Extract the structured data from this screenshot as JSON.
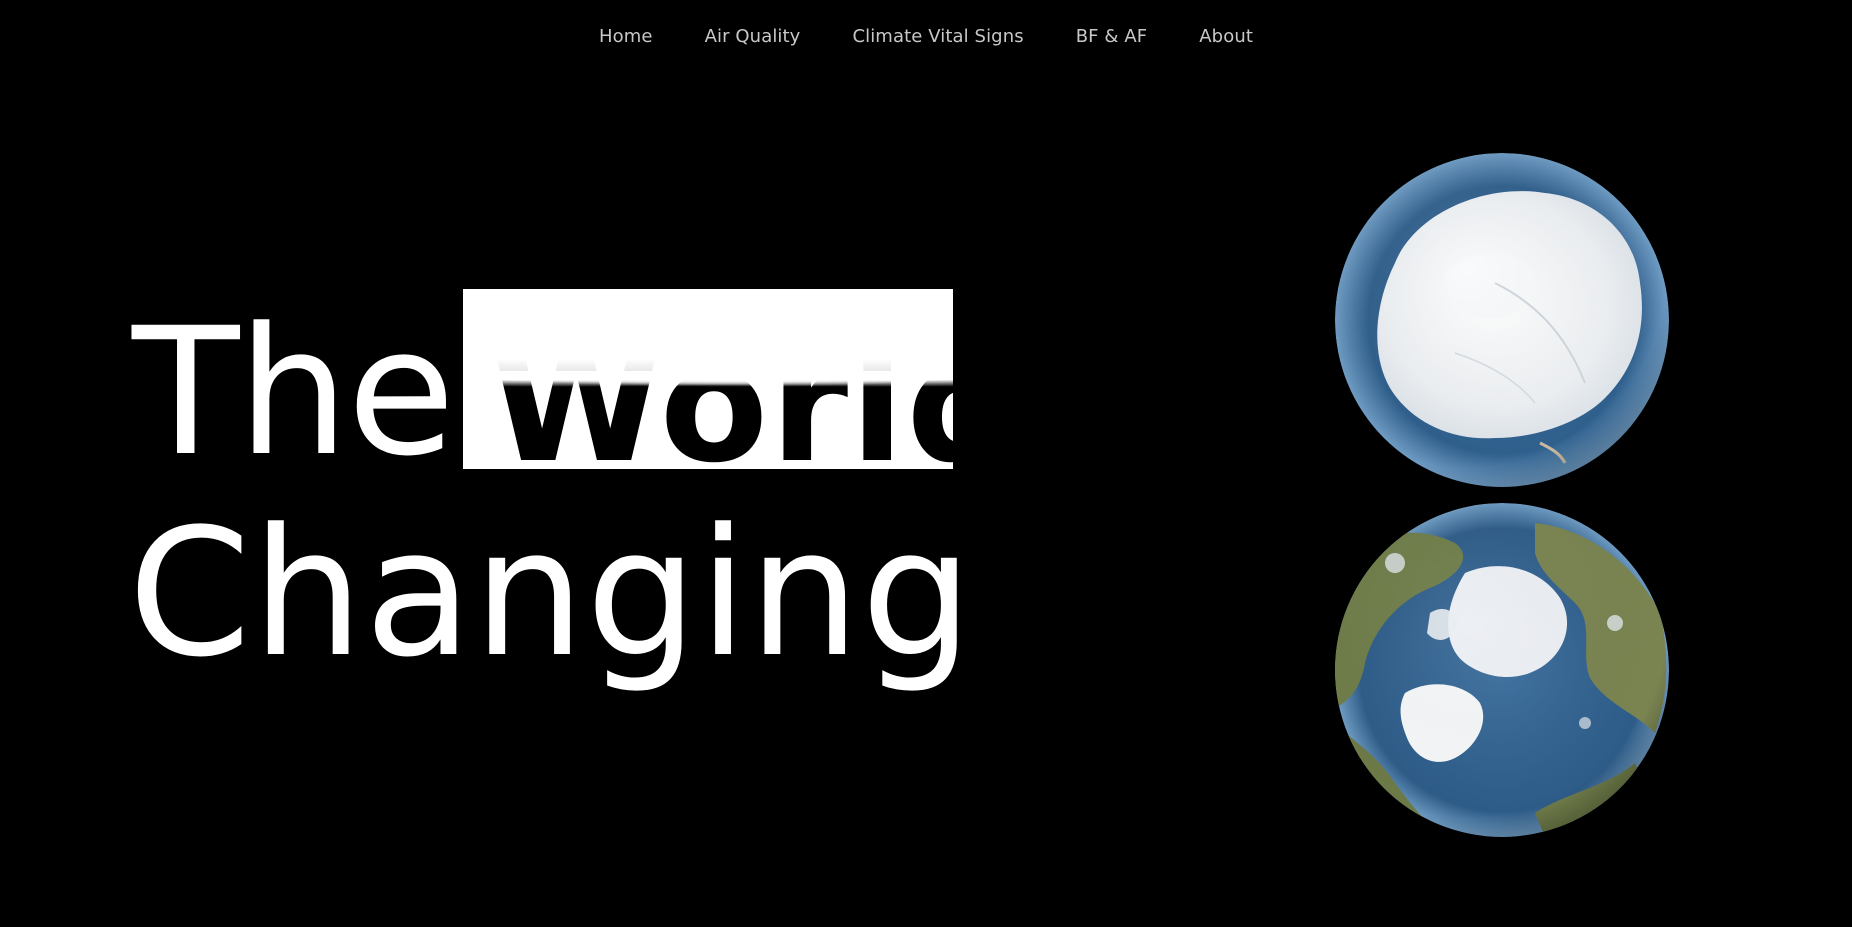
{
  "nav": {
    "items": [
      {
        "label": "Home"
      },
      {
        "label": "Air Quality"
      },
      {
        "label": "Climate Vital Signs"
      },
      {
        "label": "BF & AF"
      },
      {
        "label": "About"
      }
    ]
  },
  "hero": {
    "word_1": "The",
    "word_2": "World",
    "word_3": "Changing"
  },
  "globes": {
    "south_icon": "antarctica-globe-icon",
    "north_icon": "arctic-globe-icon"
  },
  "colors": {
    "background": "#000000",
    "text": "#ffffff",
    "nav_text": "#c8c8c8",
    "ocean": "#3a6d9a",
    "ice": "#f2f4f6",
    "land": "#6f7d4a"
  }
}
